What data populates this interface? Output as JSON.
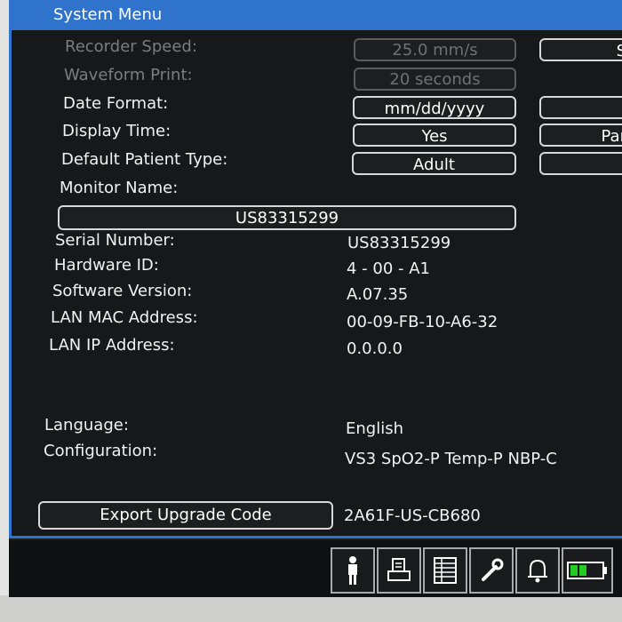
{
  "window": {
    "title": "System Menu"
  },
  "settings": {
    "recorder_speed": {
      "label": "Recorder Speed:",
      "value": "25.0 mm/s",
      "side_button": "S"
    },
    "waveform_print": {
      "label": "Waveform Print:",
      "value": "20 seconds"
    },
    "date_format": {
      "label": "Date Format:",
      "value": "mm/dd/yyyy"
    },
    "display_time": {
      "label": "Display Time:",
      "value": "Yes",
      "side_button": "Par"
    },
    "default_patient_type": {
      "label": "Default Patient Type:",
      "value": "Adult"
    },
    "monitor_name": {
      "label": "Monitor Name:",
      "value": "US83315299"
    }
  },
  "info": [
    {
      "label": "Serial Number:",
      "value": "US83315299"
    },
    {
      "label": "Hardware ID:",
      "value": "4 - 00 - A1"
    },
    {
      "label": "Software Version:",
      "value": "A.07.35"
    },
    {
      "label": "LAN MAC Address:",
      "value": "00-09-FB-10-A6-32"
    },
    {
      "label": "LAN IP Address:",
      "value": "0.0.0.0"
    }
  ],
  "language": {
    "label": "Language:",
    "value": "English"
  },
  "configuration": {
    "label": "Configuration:",
    "value": "VS3 SpO2-P Temp-P NBP-C"
  },
  "export": {
    "button_label": "Export Upgrade Code",
    "code": "2A61F-US-CB680"
  },
  "toolbar": {
    "icons": [
      "patient-icon",
      "print-icon",
      "list-icon",
      "wrench-icon",
      "alarm-bell-icon",
      "battery-icon"
    ],
    "battery_color": "#22cc22"
  },
  "colors": {
    "accent": "#2f73cc",
    "background": "#161819",
    "text": "#f2f2f2"
  }
}
